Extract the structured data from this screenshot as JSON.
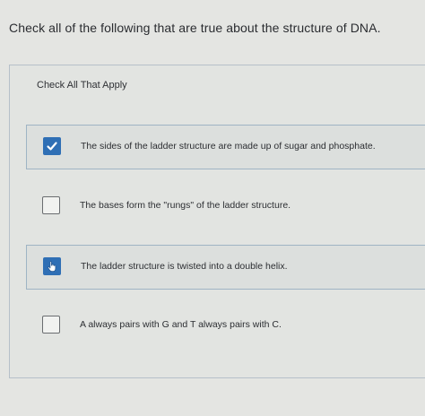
{
  "question": "Check all of the following that are true about the structure of DNA.",
  "instruction": "Check All That Apply",
  "options": [
    {
      "label": "The sides of the ladder structure are made up of sugar and phosphate.",
      "checked": true,
      "icon": "checkmark-icon"
    },
    {
      "label": "The bases form the \"rungs\" of the ladder structure.",
      "checked": false
    },
    {
      "label": "The ladder structure is twisted into a double helix.",
      "checked": true,
      "icon": "hand-pointer-icon"
    },
    {
      "label": "A always pairs with G and T always pairs with C.",
      "checked": false
    }
  ],
  "colors": {
    "accent": "#2f6fb5",
    "background": "#e4e5e2",
    "panel_border": "#b6c0c9"
  }
}
